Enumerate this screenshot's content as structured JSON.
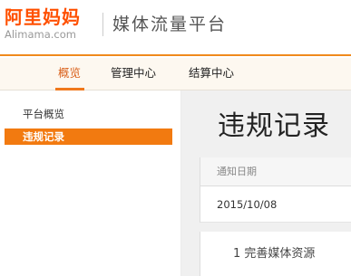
{
  "logo": {
    "cn": "阿里妈妈",
    "en": "Alimama.com"
  },
  "site_title": "媒体流量平台",
  "nav": [
    {
      "label": "概览",
      "active": true
    },
    {
      "label": "管理中心",
      "active": false
    },
    {
      "label": "结算中心",
      "active": false
    }
  ],
  "sidebar": [
    {
      "label": "平台概览",
      "active": false
    },
    {
      "label": "违规记录",
      "active": true
    }
  ],
  "main": {
    "title": "违规记录",
    "table_header": "通知日期",
    "rows": [
      "2015/10/08"
    ],
    "section_text": "1 完善媒体资源"
  },
  "colors": {
    "accent": "#f27a10",
    "logo": "#ff5000",
    "nav_active": "#d9601a"
  }
}
